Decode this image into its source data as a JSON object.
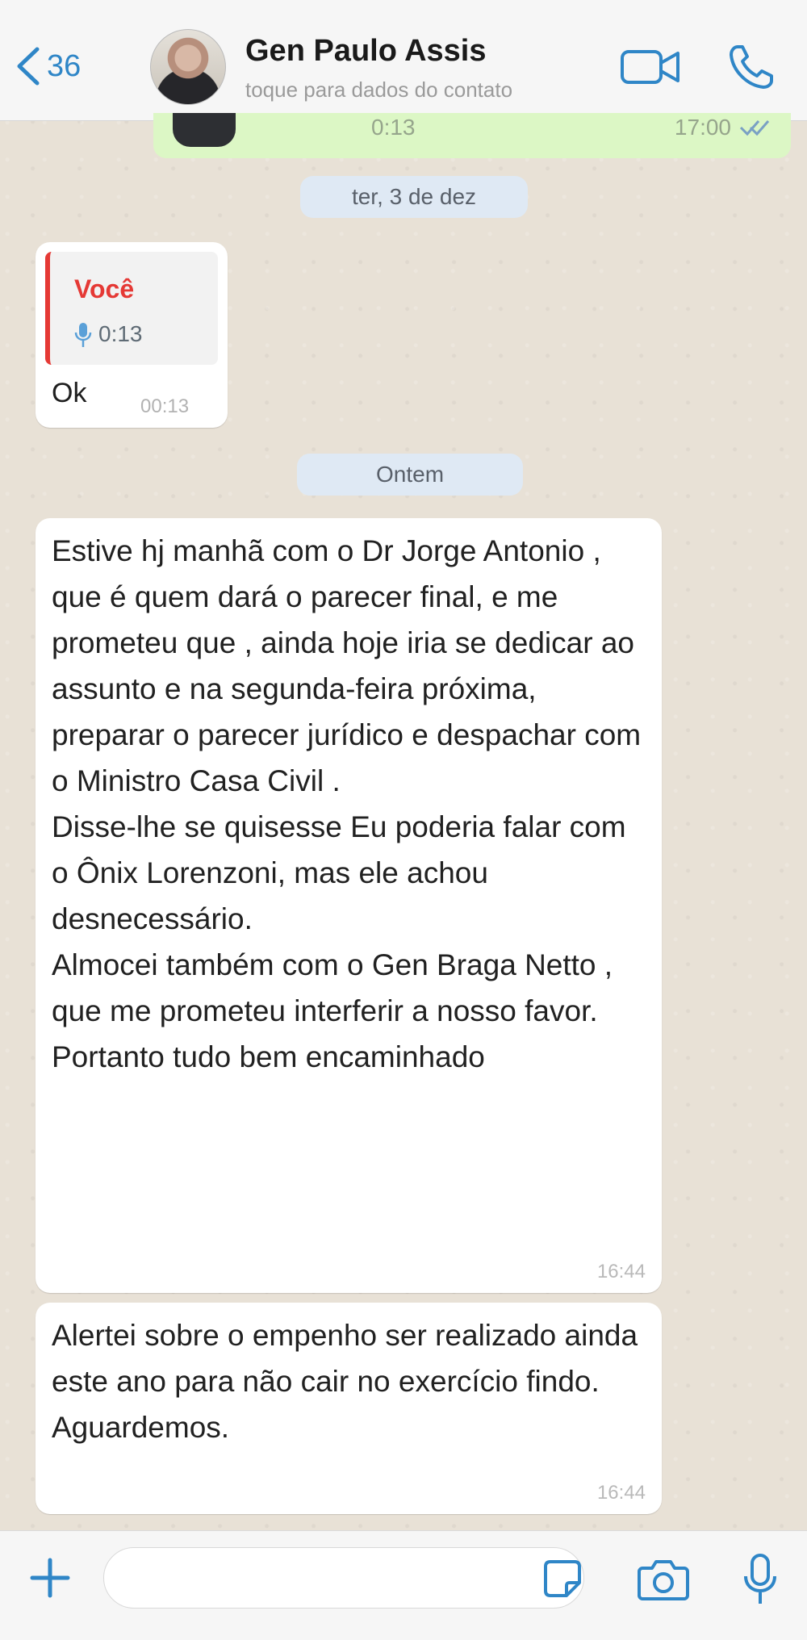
{
  "header": {
    "back_count": "36",
    "contact_name": "Gen Paulo Assis",
    "contact_subtitle": "toque para dados do contato"
  },
  "partial_message": {
    "duration": "0:13",
    "time": "17:00"
  },
  "date_separators": {
    "first": "ter, 3 de dez",
    "second": "Ontem"
  },
  "reply_message": {
    "quoted_author": "Você",
    "quoted_duration": "0:13",
    "text": "Ok",
    "time": "00:13"
  },
  "message_1": {
    "paragraphs": [
      "Estive hj manhã com o Dr Jorge Antonio , que é quem dará o parecer final, e me prometeu que , ainda hoje iria se dedicar ao assunto e na segunda-feira próxima, preparar o parecer jurídico e despachar com o Ministro Casa Civil .",
      "Disse-lhe se quisesse Eu poderia falar com o Ônix Lorenzoni, mas ele achou desnecessário.",
      "Almocei também com o Gen Braga Netto , que me prometeu interferir a nosso favor.",
      "Portanto tudo bem encaminhado"
    ],
    "time": "16:44"
  },
  "message_2": {
    "paragraphs": [
      "Alertei sobre o empenho ser realizado ainda este ano para não cair no exercício findo.",
      "Aguardemos."
    ],
    "time": "16:44"
  },
  "input": {
    "placeholder": ""
  },
  "colors": {
    "accent_blue": "#2f86c7",
    "reply_red": "#e53935",
    "outgoing_green": "#dcf7c5"
  }
}
